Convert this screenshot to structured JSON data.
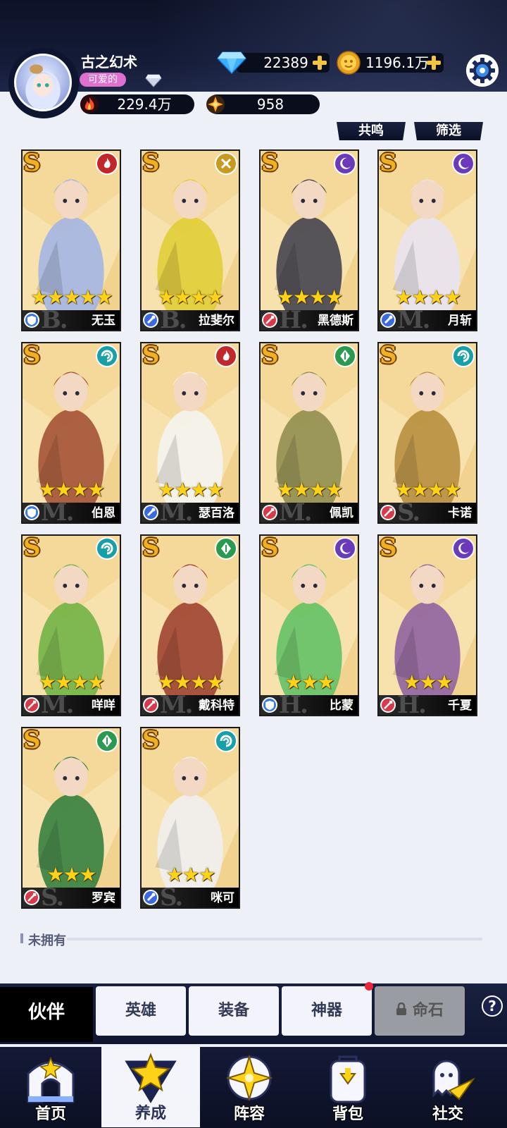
{
  "player": {
    "name": "古之幻术",
    "title": "可爱的",
    "power": "229.4万",
    "stamina": "958",
    "diamonds": "22389",
    "gold": "1196.1万"
  },
  "filters": {
    "resonance": "共鸣",
    "filter": "筛选"
  },
  "colors": {
    "fire": "#c0282c",
    "light": "#c89a20",
    "dark": "#6a3ab8",
    "wind": "#18a0a8",
    "nature": "#2a9a50",
    "defense": "#3a7ae0",
    "attack": "#d83a4a",
    "support": "#3a6ae0"
  },
  "cards": [
    {
      "name": "无玉",
      "rarity": "S",
      "stars": "★★★★★",
      "faction": "fire",
      "cls": "defense",
      "letter": "B.",
      "tone": "#9fb3e8"
    },
    {
      "name": "拉斐尔",
      "rarity": "S",
      "stars": "★★★★",
      "faction": "light",
      "cls": "support",
      "letter": "B.",
      "tone": "#e0cc30"
    },
    {
      "name": "黑德斯",
      "rarity": "S",
      "stars": "★★★★",
      "faction": "dark",
      "cls": "attack",
      "letter": "H.",
      "tone": "#3a3a4a"
    },
    {
      "name": "月斩",
      "rarity": "S",
      "stars": "★★★★",
      "faction": "dark",
      "cls": "support",
      "letter": "M.",
      "tone": "#e8e4f4"
    },
    {
      "name": "伯恩",
      "rarity": "S",
      "stars": "★★★★",
      "faction": "wind",
      "cls": "defense",
      "letter": "M.",
      "tone": "#a04a30"
    },
    {
      "name": "瑟百洛",
      "rarity": "S",
      "stars": "★★★★",
      "faction": "fire",
      "cls": "support",
      "letter": "M.",
      "tone": "#f4f4f4"
    },
    {
      "name": "佩凯",
      "rarity": "S",
      "stars": "★★★★",
      "faction": "nature",
      "cls": "attack",
      "letter": "M.",
      "tone": "#8a8a4a"
    },
    {
      "name": "卡诺",
      "rarity": "S",
      "stars": "★★★★",
      "faction": "wind",
      "cls": "attack",
      "letter": "S.",
      "tone": "#b48a3a"
    },
    {
      "name": "咩咩",
      "rarity": "S",
      "stars": "★★★★",
      "faction": "wind",
      "cls": "attack",
      "letter": "M.",
      "tone": "#6ab040"
    },
    {
      "name": "戴科特",
      "rarity": "S",
      "stars": "★★★★",
      "faction": "nature",
      "cls": "attack",
      "letter": "M.",
      "tone": "#9a3a2a"
    },
    {
      "name": "比蒙",
      "rarity": "S",
      "stars": "★★★",
      "faction": "dark",
      "cls": "defense",
      "letter": "H.",
      "tone": "#5ac060"
    },
    {
      "name": "千夏",
      "rarity": "S",
      "stars": "★★★",
      "faction": "dark",
      "cls": "attack",
      "letter": "H.",
      "tone": "#8a5aa0"
    },
    {
      "name": "罗宾",
      "rarity": "S",
      "stars": "★★★",
      "faction": "nature",
      "cls": "attack",
      "letter": "S.",
      "tone": "#2a7a3a"
    },
    {
      "name": "咪可",
      "rarity": "S",
      "stars": "★★★",
      "faction": "wind",
      "cls": "support",
      "letter": "S.",
      "tone": "#f0f0f4"
    }
  ],
  "unowned_label": "未拥有",
  "subtabs": {
    "partner": "伙伴",
    "hero": "英雄",
    "equipment": "装备",
    "artifact": "神器",
    "fatestone": "命石"
  },
  "help": "?",
  "nav": {
    "home": "首页",
    "develop": "养成",
    "lineup": "阵容",
    "bag": "背包",
    "social": "社交"
  }
}
